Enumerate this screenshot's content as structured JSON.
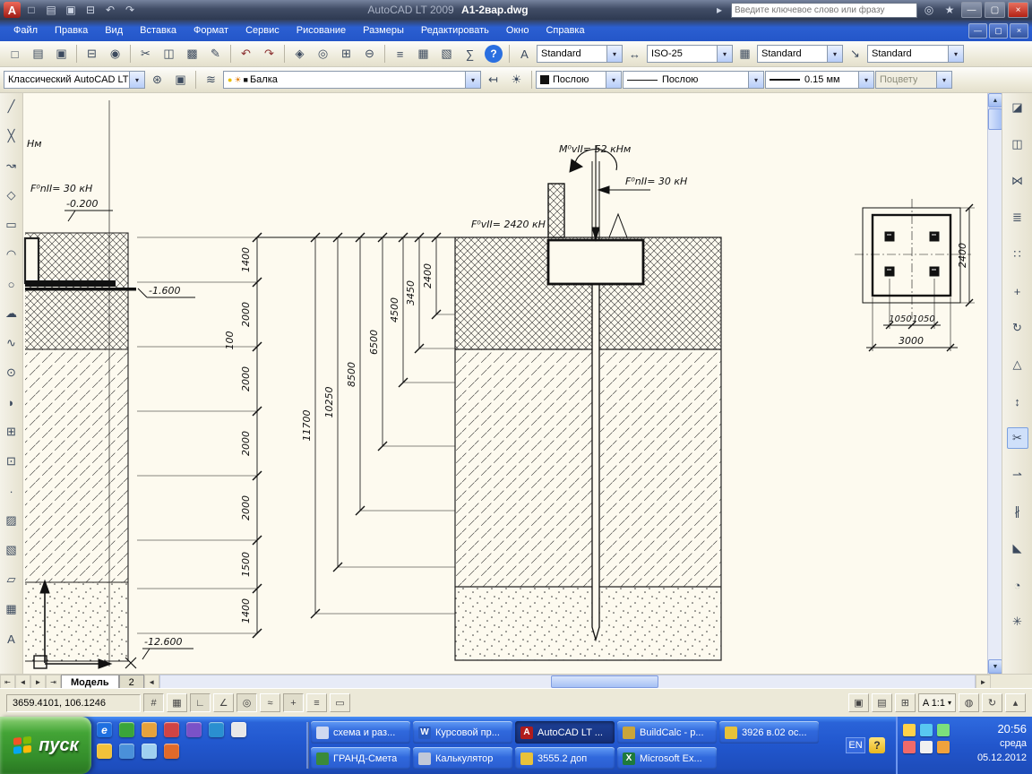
{
  "window": {
    "app_title": "AutoCAD LT 2009",
    "doc_title": "A1-2вар.dwg",
    "search_placeholder": "Введите ключевое слово или фразу"
  },
  "menus": {
    "items": [
      "Файл",
      "Правка",
      "Вид",
      "Вставка",
      "Формат",
      "Сервис",
      "Рисование",
      "Размеры",
      "Редактировать",
      "Окно",
      "Справка"
    ]
  },
  "toolbar1": {
    "text_style": "Standard",
    "dim_style": "ISO-25",
    "table_style": "Standard",
    "mleader_style": "Standard"
  },
  "toolbar2": {
    "workspace": "Классический AutoCAD LT",
    "layer": "Балка",
    "color": "Послою",
    "linetype": "Послою",
    "lineweight": "0.15 мм",
    "plot_style": "Поцвету"
  },
  "drawing": {
    "partial_text": "Нм",
    "force_left": "F⁰nII= 30 кН",
    "level_top": "-0.200",
    "level_mid": "-1.600",
    "level_bottom": "-12.600",
    "moment": "M⁰vII= 52 кНм",
    "force_top": "F⁰nII= 30 кН",
    "force_vert": "F⁰vII= 2420 кН",
    "chain": [
      "1400",
      "2000",
      "2000",
      "2000",
      "2000",
      "1500",
      "1400"
    ],
    "small_dim": "100",
    "depths": [
      "11700",
      "10250",
      "8500",
      "6500",
      "4500",
      "3450",
      "2400"
    ],
    "plan": {
      "d1": "1050",
      "d2": "1050",
      "total": "3000",
      "side": "2400"
    }
  },
  "tabs": {
    "model": "Модель",
    "layout2": "2"
  },
  "statusbar": {
    "coords": "3659.4101, 106.1246",
    "scale": "A 1:1"
  },
  "taskbar": {
    "start": "пуск",
    "row1": [
      "схема и раз...",
      "Курсовой пр...",
      "AutoCAD LT ...",
      "BuildCalc - p...",
      "3926 в.02 ос..."
    ],
    "row2": [
      "ГРАНД-Смета",
      "Калькулятор",
      "3555.2  доп",
      "Microsoft Ex..."
    ],
    "tray": {
      "lang": "EN",
      "time": "20:56",
      "weekday": "среда",
      "date": "05.12.2012"
    }
  },
  "colors": {
    "taskbar_blue": "#2258cf",
    "start_green": "#3f9c36",
    "canvas_cream": "#fdfaef",
    "menu_blue": "#2b5fd2",
    "titlebar_slate": "#414d66",
    "autocad_red": "#b01c1c"
  },
  "icons": {
    "logo": "A",
    "play": "▸",
    "search": "◎",
    "star": "★",
    "min": "—",
    "max": "▢",
    "close": "×",
    "new": "□",
    "open": "▤",
    "save": "▣",
    "print": "⊟",
    "preview": "◉",
    "cut": "✂",
    "copy": "◫",
    "paste": "▩",
    "matchprop": "✎",
    "undo": "↶",
    "redo": "↷",
    "pan": "◈",
    "zoom": "◎",
    "zoomwin": "⊞",
    "zoomprev": "⊖",
    "props": "≡",
    "dcenter": "▦",
    "palettes": "▧",
    "calc": "∑",
    "help": "?",
    "textstyle": "A",
    "dimstyle": "↔",
    "tablestyle": "▦",
    "mleader": "↘",
    "gear": "⊛",
    "wsave": "▣",
    "layers": "≋",
    "layerprev": "↤",
    "layerstate": "☀",
    "bulb": "●",
    "sun": "☀",
    "swatch": "■",
    "line": "╱",
    "xline": "╳",
    "pline": "↝",
    "polygon": "◇",
    "rect": "▭",
    "arc": "◠",
    "circle": "○",
    "cloud": "☁",
    "spline": "∿",
    "ellipse": "⊙",
    "earc": "◗",
    "insert": "⊞",
    "block": "⊡",
    "point": "∙",
    "hatch": "▨",
    "gradient": "▧",
    "region": "▱",
    "table": "▦",
    "mtext": "A",
    "erase": "◪",
    "copy2": "◫",
    "mirror": "⋈",
    "offset": "≣",
    "array": "∷",
    "move": "+",
    "rotate": "↻",
    "scale": "△",
    "stretch": "↕",
    "trim": "✂",
    "extend": "⇀",
    "brk": "∦",
    "chamfer": "◣",
    "fillet": "◔",
    "explode": "✳",
    "snap": "#",
    "grid": "▦",
    "ortho": "∟",
    "polar": "∠",
    "osnap": "◎",
    "otrack": "≈",
    "dyn": "+",
    "lwt": "≡",
    "model": "▭",
    "msbtn": "▣",
    "laybtn": "▤",
    "qv": "⊞",
    "annovis": "◍",
    "autoscale": "↻",
    "trayup": "▴",
    "chevdown": "▾",
    "up": "▲",
    "down": "▼",
    "left": "◄",
    "right": "►",
    "tabfirst": "⇤",
    "tablast": "⇥",
    "ie": "e",
    "word": "W",
    "acad": "A",
    "excel": "X"
  }
}
